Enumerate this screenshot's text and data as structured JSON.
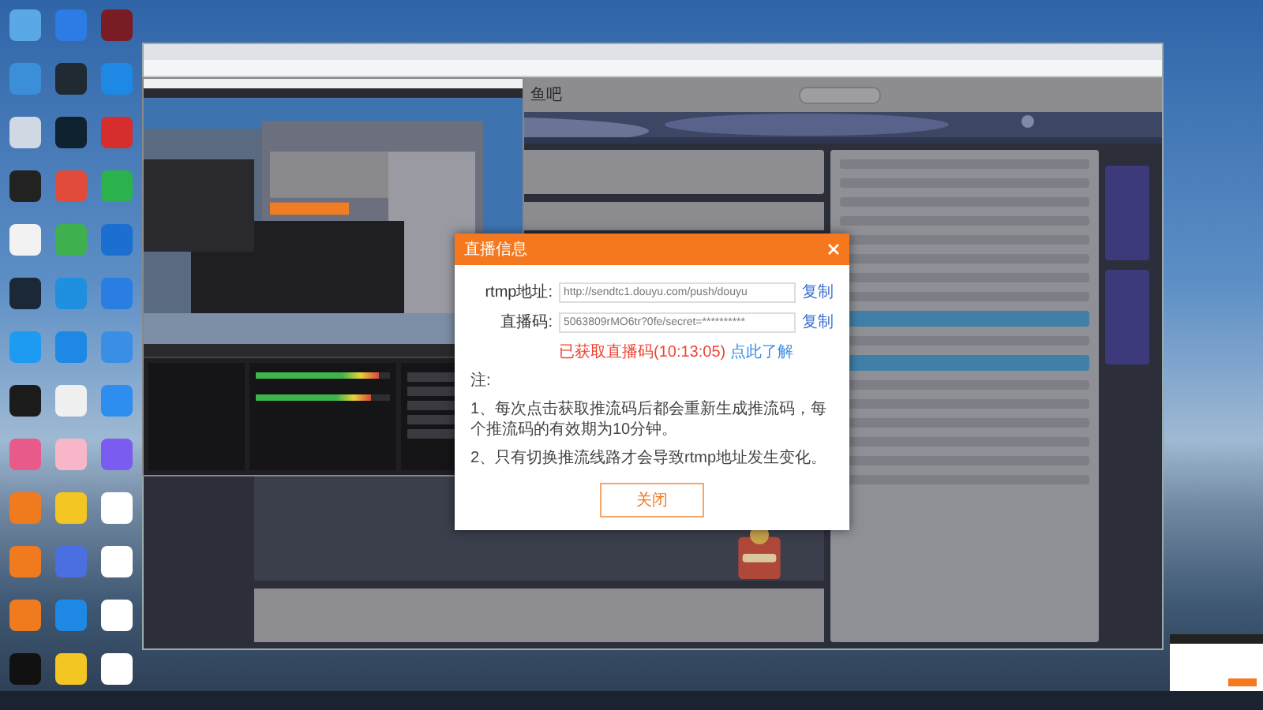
{
  "desktop": {
    "icons": [
      {
        "color": "#5aa9e6"
      },
      {
        "color": "#2d7be5"
      },
      {
        "color": "#7a1c24"
      },
      {
        "color": "#3b8fd9"
      },
      {
        "color": "#1f2a33"
      },
      {
        "color": "#1e88e5"
      },
      {
        "color": "#cfd8e3"
      },
      {
        "color": "#0f2230"
      },
      {
        "color": "#d62d2d"
      },
      {
        "color": "#222222"
      },
      {
        "color": "#e14b3b"
      },
      {
        "color": "#2bb24c"
      },
      {
        "color": "#f2f2f2"
      },
      {
        "color": "#3fb04e"
      },
      {
        "color": "#1a6fd1"
      },
      {
        "color": "#1b2838"
      },
      {
        "color": "#1f8fe0"
      },
      {
        "color": "#2a7de1"
      },
      {
        "color": "#1d9bf0"
      },
      {
        "color": "#1e88e5"
      },
      {
        "color": "#3a8ee6"
      },
      {
        "color": "#1b1b1b"
      },
      {
        "color": "#f0f0f0"
      },
      {
        "color": "#2d8ef0"
      },
      {
        "color": "#e85a8a"
      },
      {
        "color": "#f7b7c8"
      },
      {
        "color": "#7a5cf0"
      },
      {
        "color": "#f07b1f"
      },
      {
        "color": "#f3c623"
      },
      {
        "color": "#ffffff"
      },
      {
        "color": "#f07b1f"
      },
      {
        "color": "#4a6fe0"
      },
      {
        "color": "#ffffff"
      },
      {
        "color": "#f07b1f"
      },
      {
        "color": "#1e88e5"
      },
      {
        "color": "#ffffff"
      },
      {
        "color": "#111111"
      },
      {
        "color": "#f3c623"
      },
      {
        "color": "#ffffff"
      }
    ]
  },
  "browser": {
    "page": {
      "logo": "鱼吧"
    }
  },
  "obs": {
    "mixer": [
      {
        "level": 0.92
      },
      {
        "level": 0.86
      }
    ]
  },
  "dialog": {
    "title": "直播信息",
    "fields": [
      {
        "label": "rtmp地址:",
        "value": "http://sendtc1.douyu.com/push/douyu",
        "action": "复制"
      },
      {
        "label": "直播码:",
        "value": "5063809rMO6tr?0fe/secret=**********",
        "action": "复制"
      }
    ],
    "status": "已获取直播码(10:13:05)",
    "link": "点此了解",
    "note_title": "注:",
    "notes": [
      "1、每次点击获取推流码后都会重新生成推流码，每个推流码的有效期为10分钟。",
      "2、只有切换推流线路才会导致rtmp地址发生变化。"
    ],
    "button": "关闭"
  }
}
